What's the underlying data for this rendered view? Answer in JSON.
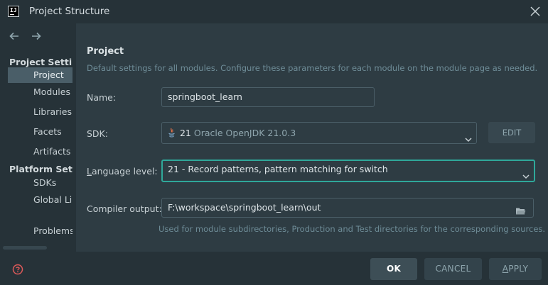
{
  "window": {
    "title": "Project Structure",
    "logo_text": "IJ"
  },
  "sidebar": {
    "section_project": "Project Settings",
    "section_platform": "Platform Settings",
    "items": [
      {
        "label": "Project"
      },
      {
        "label": "Modules"
      },
      {
        "label": "Libraries"
      },
      {
        "label": "Facets"
      },
      {
        "label": "Artifacts"
      },
      {
        "label": "SDKs"
      },
      {
        "label": "Global Libraries"
      },
      {
        "label": "Problems"
      }
    ],
    "selected_index": 0
  },
  "main": {
    "title": "Project",
    "description": "Default settings for all modules. Configure these parameters for each module on the module page as needed.",
    "name": {
      "label": "Name:",
      "value": "springboot_learn"
    },
    "sdk": {
      "label": "SDK:",
      "version": "21",
      "name": "Oracle OpenJDK 21.0.3",
      "edit_label": "EDIT"
    },
    "language_level": {
      "label_prefix": "L",
      "label_rest": "anguage level:",
      "value": "21 - Record patterns, pattern matching for switch"
    },
    "compiler_output": {
      "label": "Compiler output:",
      "value": "F:\\workspace\\springboot_learn\\out",
      "hint": "Used for module subdirectories, Production and Test directories for the corresponding sources."
    }
  },
  "buttons": {
    "ok": "OK",
    "cancel": "CANCEL",
    "apply_prefix": "A",
    "apply_rest": "PPLY"
  },
  "colors": {
    "background": "#263238",
    "panel": "#2e3c43",
    "accent_focus": "#2fa89a",
    "selection": "#4a5e68",
    "help_icon": "#e05a5a"
  },
  "icons": [
    "app-logo",
    "close-icon",
    "back-arrow-icon",
    "forward-arrow-icon",
    "java-icon",
    "chevron-down-icon",
    "folder-icon",
    "help-icon"
  ]
}
